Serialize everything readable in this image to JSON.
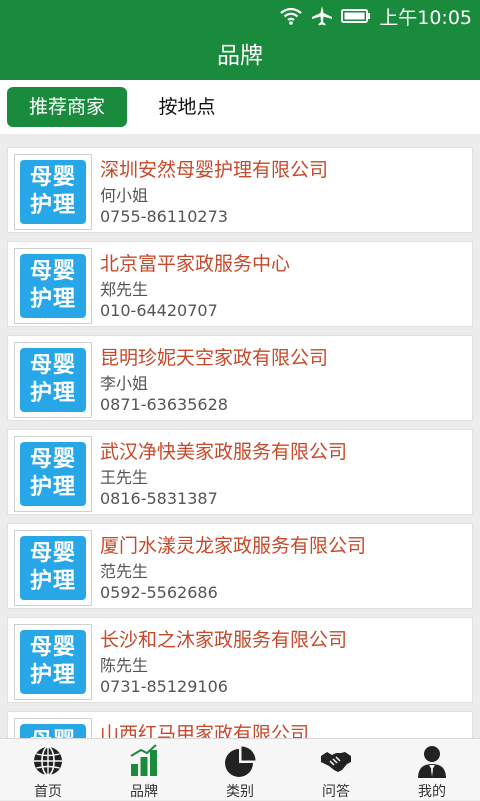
{
  "status_bar": {
    "time": "上午10:05",
    "icons": [
      "wifi-icon",
      "airplane-icon",
      "battery-icon"
    ]
  },
  "title": "品牌",
  "tabs": [
    {
      "label": "推荐商家",
      "active": true
    },
    {
      "label": "按地点",
      "active": false
    }
  ],
  "logo_text": [
    "母婴",
    "护理"
  ],
  "businesses": [
    {
      "name": "深圳安然母婴护理有限公司",
      "contact": "何小姐",
      "phone": "0755-86110273"
    },
    {
      "name": "北京富平家政服务中心",
      "contact": "郑先生",
      "phone": "010-64420707"
    },
    {
      "name": "昆明珍妮天空家政有限公司",
      "contact": "李小姐",
      "phone": "0871-63635628"
    },
    {
      "name": "武汉净快美家政服务有限公司",
      "contact": "王先生",
      "phone": "0816-5831387"
    },
    {
      "name": "厦门水漾灵龙家政服务有限公司",
      "contact": "范先生",
      "phone": "0592-5562686"
    },
    {
      "name": "长沙和之沐家政服务有限公司",
      "contact": "陈先生",
      "phone": "0731-85129106"
    },
    {
      "name": "山西红马甲家政有限公司",
      "contact": "",
      "phone": ""
    }
  ],
  "bottom_nav": [
    {
      "label": "首页",
      "icon": "globe-icon"
    },
    {
      "label": "品牌",
      "icon": "bar-chart-icon"
    },
    {
      "label": "类别",
      "icon": "pie-chart-icon"
    },
    {
      "label": "问答",
      "icon": "handshake-icon"
    },
    {
      "label": "我的",
      "icon": "user-icon"
    }
  ],
  "colors": {
    "primary": "#1a8a3c",
    "name_text": "#c8492a",
    "logo_bg": "#27a7e8",
    "background": "#ececec"
  }
}
